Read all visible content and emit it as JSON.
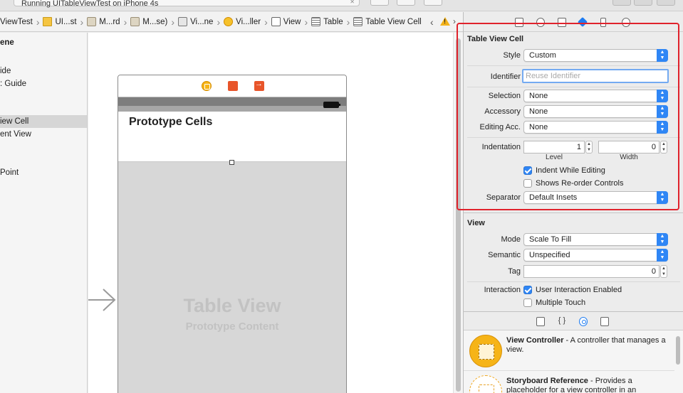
{
  "toolbar": {
    "run_status": "Running UITableViewTest on iPhone 4s"
  },
  "jumpbar": {
    "crumbs": [
      {
        "label": "ViewTest",
        "icon": "project-icon"
      },
      {
        "label": "UI...st",
        "icon": "folder-icon"
      },
      {
        "label": "M...rd",
        "icon": "storyboard-file-icon"
      },
      {
        "label": "M...se)",
        "icon": "storyboard-file-icon"
      },
      {
        "label": "Vi...ne",
        "icon": "scene-icon"
      },
      {
        "label": "Vi...ller",
        "icon": "view-controller-icon"
      },
      {
        "label": "View",
        "icon": "view-icon"
      },
      {
        "label": "Table",
        "icon": "table-icon"
      },
      {
        "label": "Table View Cell",
        "icon": "table-cell-icon"
      }
    ],
    "back_glyph": "‹",
    "forward_glyph": "›"
  },
  "outline": {
    "items": [
      {
        "label": "ene",
        "style": "header"
      },
      {
        "label": "ide",
        "style": ""
      },
      {
        "label": ": Guide",
        "style": ""
      },
      {
        "label": "iew Cell",
        "style": "selected"
      },
      {
        "label": "ent View",
        "style": ""
      },
      {
        "label": "Point",
        "style": ""
      }
    ]
  },
  "canvas": {
    "prototype_title": "Prototype Cells",
    "table_view_title": "Table View",
    "table_view_subtitle": "Prototype Content"
  },
  "inspector": {
    "cell_section": {
      "title": "Table View Cell",
      "style_label": "Style",
      "style_value": "Custom",
      "identifier_label": "Identifier",
      "identifier_placeholder": "Reuse Identifier",
      "selection_label": "Selection",
      "selection_value": "None",
      "accessory_label": "Accessory",
      "accessory_value": "None",
      "editing_acc_label": "Editing Acc.",
      "editing_acc_value": "None",
      "indentation_label": "Indentation",
      "indent_level_value": "1",
      "indent_width_value": "0",
      "level_caption": "Level",
      "width_caption": "Width",
      "indent_while_editing_label": "Indent While Editing",
      "indent_while_editing_checked": true,
      "reorder_controls_label": "Shows Re-order Controls",
      "reorder_controls_checked": false,
      "separator_label": "Separator",
      "separator_value": "Default Insets"
    },
    "view_section": {
      "title": "View",
      "mode_label": "Mode",
      "mode_value": "Scale To Fill",
      "semantic_label": "Semantic",
      "semantic_value": "Unspecified",
      "tag_label": "Tag",
      "tag_value": "0",
      "interaction_label": "Interaction",
      "user_interaction_label": "User Interaction Enabled",
      "user_interaction_checked": true,
      "multiple_touch_label": "Multiple Touch",
      "multiple_touch_checked": false
    }
  },
  "library": {
    "items": [
      {
        "title": "View Controller",
        "description": " - A controller that manages a view."
      },
      {
        "title": "Storyboard Reference",
        "description": " - Provides a placeholder for a view controller in an"
      }
    ]
  },
  "colors": {
    "accent_blue": "#2f86f5",
    "highlight_red": "#e0222c"
  }
}
